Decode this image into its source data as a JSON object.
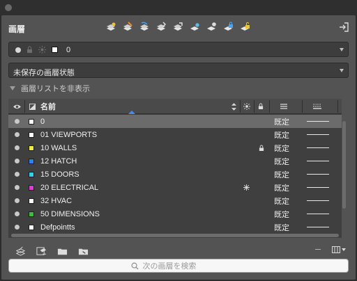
{
  "panel": {
    "title": "画層"
  },
  "current_layer": {
    "name": "0"
  },
  "layer_state": {
    "label": "未保存の画層状態"
  },
  "list_toggle": {
    "label": "画層リストを非表示"
  },
  "columns": {
    "name_header": "名前"
  },
  "layers": [
    {
      "name": "0",
      "color": "#ffffff",
      "linetype": "既定",
      "frozen": false,
      "locked": false,
      "selected": true
    },
    {
      "name": "01 VIEWPORTS",
      "color": "#ffffff",
      "linetype": "既定",
      "frozen": false,
      "locked": false,
      "selected": false
    },
    {
      "name": "10 WALLS",
      "color": "#f2e84a",
      "linetype": "既定",
      "frozen": false,
      "locked": true,
      "selected": false
    },
    {
      "name": "12 HATCH",
      "color": "#2e7ff0",
      "linetype": "既定",
      "frozen": false,
      "locked": false,
      "selected": false
    },
    {
      "name": "15 DOORS",
      "color": "#2fd3e6",
      "linetype": "既定",
      "frozen": false,
      "locked": false,
      "selected": false
    },
    {
      "name": "20 ELECTRICAL",
      "color": "#e33ad6",
      "linetype": "既定",
      "frozen": true,
      "locked": false,
      "selected": false
    },
    {
      "name": "32 HVAC",
      "color": "#ffffff",
      "linetype": "既定",
      "frozen": false,
      "locked": false,
      "selected": false
    },
    {
      "name": "50 DIMENSIONS",
      "color": "#3fbe3a",
      "linetype": "既定",
      "frozen": false,
      "locked": false,
      "selected": false
    },
    {
      "name": "Defpointts",
      "color": "#ffffff",
      "linetype": "既定",
      "frozen": false,
      "locked": false,
      "selected": false
    }
  ],
  "search": {
    "placeholder": "次の画層を検索"
  }
}
